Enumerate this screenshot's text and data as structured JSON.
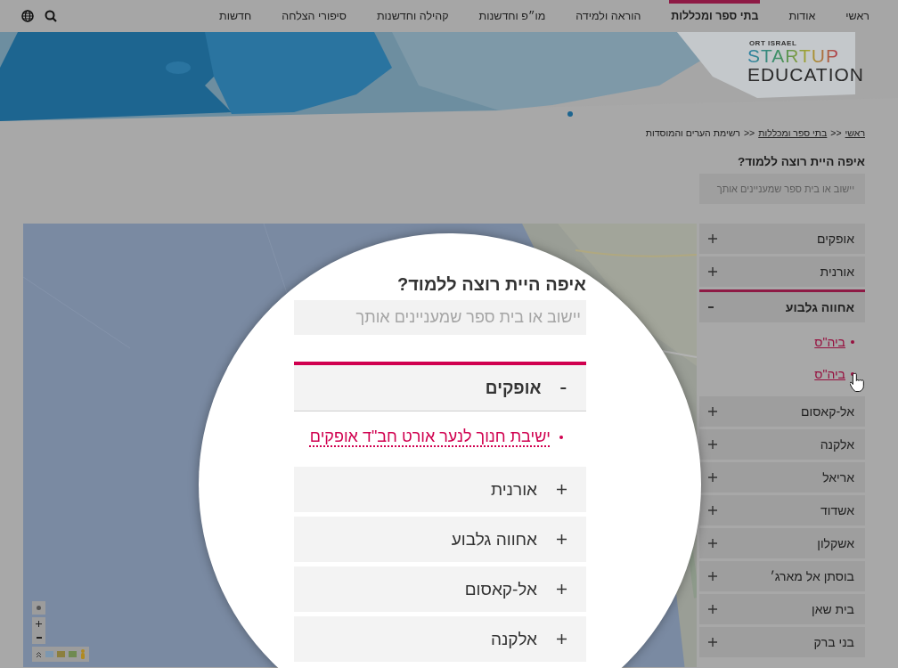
{
  "nav": {
    "items": [
      {
        "label": "ראשי",
        "selected": false
      },
      {
        "label": "אודות",
        "selected": false
      },
      {
        "label": "בתי ספר ומכללות",
        "selected": true
      },
      {
        "label": "הוראה ולמידה",
        "selected": false
      },
      {
        "label": "מו״פ וחדשנות",
        "selected": false
      },
      {
        "label": "קהילה וחדשנות",
        "selected": false
      },
      {
        "label": "סיפורי הצלחה",
        "selected": false
      },
      {
        "label": "חדשות",
        "selected": false
      }
    ]
  },
  "logo": {
    "top": "ORT ISRAEL",
    "line1": "STARTUP",
    "line2": "EDUCATION"
  },
  "breadcrumb": [
    {
      "label": "ראשי",
      "kind": "link"
    },
    {
      "label": ">>",
      "kind": "separator"
    },
    {
      "label": "בתי ספר ומכללות",
      "kind": "link"
    },
    {
      "label": ">>",
      "kind": "separator"
    },
    {
      "label": "רשימת הערים והמוסדות",
      "kind": "current"
    }
  ],
  "search": {
    "heading": "איפה היית רוצה ללמוד?",
    "placeholder": "יישוב או בית ספר שמעניינים אותך"
  },
  "cities": [
    {
      "name": "אופקים",
      "expanded": false
    },
    {
      "name": "אורנית",
      "expanded": false
    },
    {
      "name": "אחווה גלבוע",
      "expanded": true,
      "children": [
        {
          "label": "ביה\"ס"
        },
        {
          "label": "ביה\"ס"
        }
      ]
    },
    {
      "name": "אל-קאסום",
      "expanded": false
    },
    {
      "name": "אלקנה",
      "expanded": false
    },
    {
      "name": "אריאל",
      "expanded": false
    },
    {
      "name": "אשדוד",
      "expanded": false
    },
    {
      "name": "אשקלון",
      "expanded": false
    },
    {
      "name": "בוסתן אל מארג׳",
      "expanded": false
    },
    {
      "name": "בית שאן",
      "expanded": false
    },
    {
      "name": "בני ברק",
      "expanded": false
    }
  ],
  "magnifier": {
    "heading": "איפה היית רוצה ללמוד?",
    "placeholder": "יישוב או בית ספר שמעניינים אותך",
    "cities": [
      {
        "name": "אופקים",
        "expanded": true,
        "children": [
          {
            "label": "ישיבת חנוך לנער אורט חב\"ד אופקים"
          }
        ]
      },
      {
        "name": "אורנית",
        "expanded": false
      },
      {
        "name": "אחווה גלבוע",
        "expanded": false
      },
      {
        "name": "אל-קאסום",
        "expanded": false
      },
      {
        "name": "אלקנה",
        "expanded": false
      }
    ]
  }
}
